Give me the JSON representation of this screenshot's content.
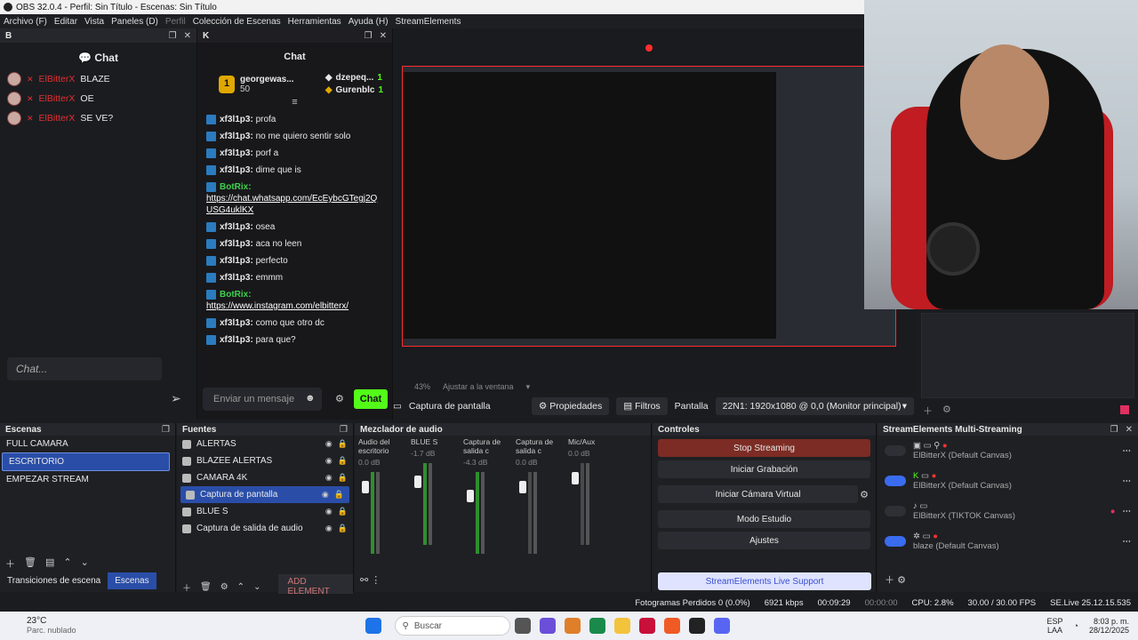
{
  "window": {
    "title": "OBS 32.0.4 - Perfil: Sin Título - Escenas: Sin Título"
  },
  "menu": {
    "items": [
      "Archivo (F)",
      "Editar",
      "Vista",
      "Paneles (D)",
      "Perfil",
      "Colección de Escenas",
      "Herramientas",
      "Ayuda (H)",
      "StreamElements"
    ]
  },
  "chat_b": {
    "dock_label": "B",
    "title": "Chat",
    "messages": [
      {
        "user": "ElBitterX",
        "text": "BLAZE"
      },
      {
        "user": "ElBitterX",
        "text": "OE"
      },
      {
        "user": "ElBitterX",
        "text": "SE VE?"
      }
    ],
    "input_placeholder": "Chat..."
  },
  "chat_k": {
    "dock_label": "K",
    "title": "Chat",
    "leaderboard": [
      {
        "rank": "1",
        "name": "georgewas...",
        "value": "50"
      },
      {
        "name": "dzepeq...",
        "value": "1"
      },
      {
        "name": "Gurenblc",
        "value": "1"
      }
    ],
    "messages": [
      {
        "user": "xf3l1p3:",
        "text": "profa"
      },
      {
        "user": "xf3l1p3:",
        "text": "no me quiero sentir solo"
      },
      {
        "user": "xf3l1p3:",
        "text": "porf a"
      },
      {
        "user": "xf3l1p3:",
        "text": "dime que is"
      },
      {
        "user": "BotRix:",
        "text": "https://chat.whatsapp.com/EcEybcGTegj2QUSG4uklKX",
        "link": true
      },
      {
        "user": "xf3l1p3:",
        "text": "osea"
      },
      {
        "user": "xf3l1p3:",
        "text": "aca no leen"
      },
      {
        "user": "xf3l1p3:",
        "text": "perfecto"
      },
      {
        "user": "xf3l1p3:",
        "text": "emmm"
      },
      {
        "user": "BotRix:",
        "text": "https://www.instagram.com/elbitterx/",
        "link": true
      },
      {
        "user": "xf3l1p3:",
        "text": "como que otro dc"
      },
      {
        "user": "xf3l1p3:",
        "text": "para que?"
      }
    ],
    "input_placeholder": "Enviar un mensaje",
    "send_label": "Chat"
  },
  "preview": {
    "zoom": "43%",
    "fit_label": "Ajustar a la ventana"
  },
  "source_bar": {
    "source_name": "Captura de pantalla",
    "properties": "Propiedades",
    "filters": "Filtros",
    "display_label": "Pantalla",
    "display_value": "22N1: 1920x1080 @ 0,0 (Monitor principal)"
  },
  "scenes": {
    "title": "Escenas",
    "items": [
      "FULL CAMARA",
      "ESCRITORIO",
      "EMPEZAR STREAM"
    ],
    "selected": 1,
    "tab_transitions": "Transiciones de escena",
    "tab_scenes": "Escenas"
  },
  "sources": {
    "title": "Fuentes",
    "items": [
      "ALERTAS",
      "BLAZEE ALERTAS",
      "CAMARA 4K",
      "Captura de pantalla",
      "BLUE S",
      "Captura de salida de audio"
    ],
    "selected": 3,
    "add_element": "ADD ELEMENT"
  },
  "mixer": {
    "title": "Mezclador de audio",
    "channels": [
      {
        "name": "Audio del escritorio",
        "db": "0.0 dB"
      },
      {
        "name": "BLUE S",
        "db": "-1.7 dB"
      },
      {
        "name": "Captura de salida c",
        "db": "-4.3 dB"
      },
      {
        "name": "Captura de salida c",
        "db": "0.0 dB"
      },
      {
        "name": "Mic/Aux",
        "db": "0.0 dB"
      }
    ]
  },
  "controls": {
    "title": "Controles",
    "stop_streaming": "Stop Streaming",
    "start_recording": "Iniciar Grabación",
    "virtual_camera": "Iniciar Cámara Virtual",
    "studio_mode": "Modo Estudio",
    "settings": "Ajustes",
    "support": "StreamElements Live Support"
  },
  "multistream": {
    "title": "StreamElements Multi-Streaming",
    "targets": [
      {
        "name": "ElBitterX (Default Canvas)",
        "on": false
      },
      {
        "name": "ElBitterX (Default Canvas)",
        "on": true
      },
      {
        "name": "ElBitterX (TIKTOK Canvas)",
        "on": false
      },
      {
        "name": "blaze (Default Canvas)",
        "on": true
      }
    ]
  },
  "status": {
    "frames_dropped": "Fotogramas Perdidos 0 (0.0%)",
    "bitrate": "6921 kbps",
    "stream_time": "00:09:29",
    "rec_time": "00:00:00",
    "cpu": "CPU: 2.8%",
    "fps": "30.00 / 30.00 FPS",
    "version": "SE.Live 25.12.15.535"
  },
  "taskbar": {
    "temp": "23°C",
    "weather": "Parc. nublado",
    "search": "Buscar",
    "lang1": "ESP",
    "lang2": "LAA",
    "time": "8:03 p. m.",
    "date": "28/12/2025"
  }
}
